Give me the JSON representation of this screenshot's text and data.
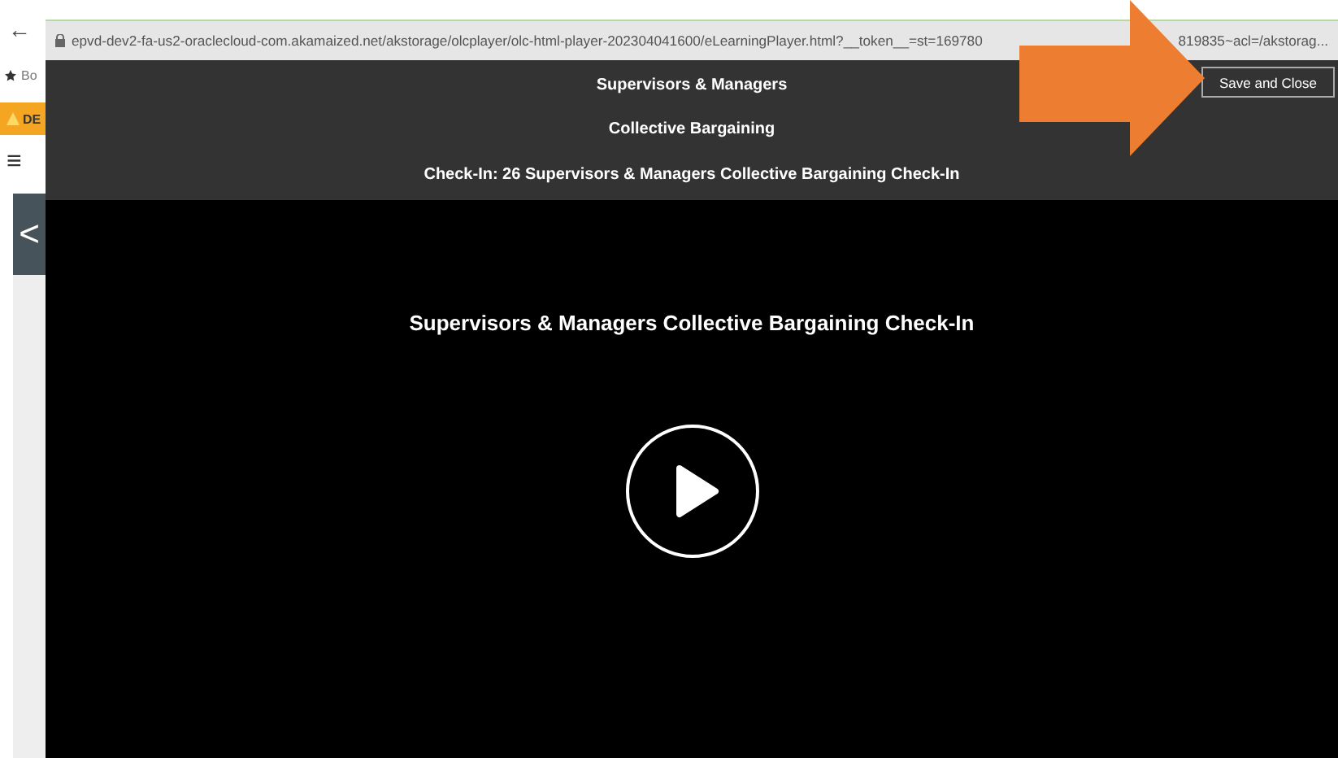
{
  "browser_strip": {
    "back": "←",
    "bookmark": "Bo",
    "warning": "DE",
    "menu": "≡",
    "collapse": "<"
  },
  "address_bar": {
    "url_start": "epvd-dev2-fa-us2-oraclecloud-com.akamaized.net/akstorage/olcplayer/olc-html-player-202304041600/eLearningPlayer.html?__token__=st=169780",
    "url_end": "819835~acl=/akstorag..."
  },
  "header": {
    "lines": [
      "Supervisors & Managers",
      "Collective Bargaining",
      "Check-In: 26 Supervisors & Managers Collective Bargaining Check-In"
    ],
    "button": "Save and Close"
  },
  "player": {
    "title": "Supervisors & Managers Collective Bargaining Check-In"
  }
}
